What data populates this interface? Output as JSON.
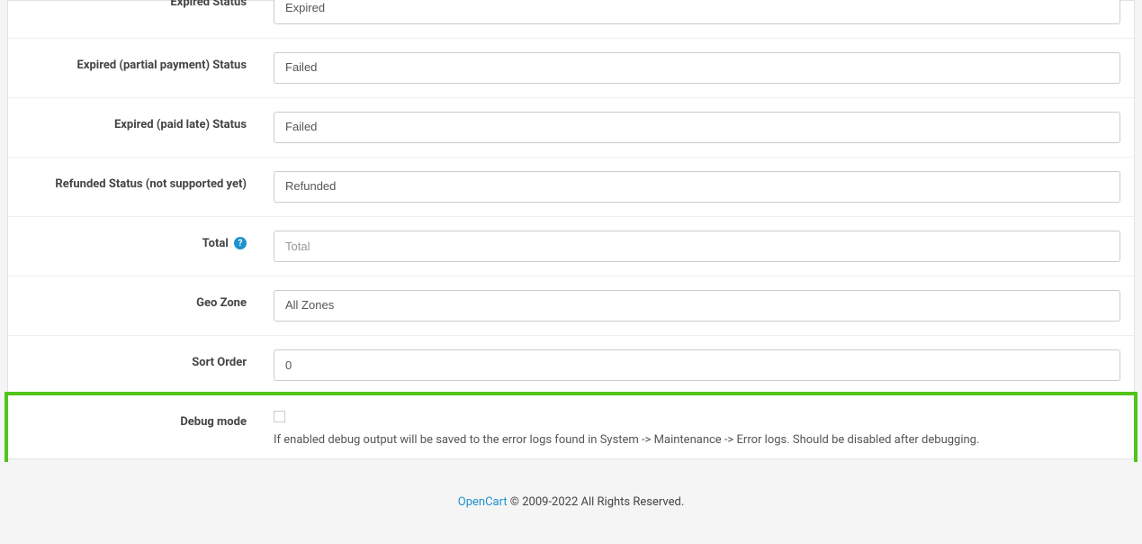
{
  "fields": {
    "expired_status": {
      "label": "Expired Status",
      "value": "Expired"
    },
    "expired_partial": {
      "label": "Expired (partial payment) Status",
      "value": "Failed"
    },
    "expired_paid_late": {
      "label": "Expired (paid late) Status",
      "value": "Failed"
    },
    "refunded": {
      "label": "Refunded Status (not supported yet)",
      "value": "Refunded"
    },
    "total": {
      "label": "Total",
      "placeholder": "Total",
      "value": ""
    },
    "geo_zone": {
      "label": "Geo Zone",
      "value": "All Zones"
    },
    "sort_order": {
      "label": "Sort Order",
      "value": "0"
    },
    "debug_mode": {
      "label": "Debug mode",
      "help": "If enabled debug output will be saved to the error logs found in System -> Maintenance -> Error logs. Should be disabled after debugging."
    }
  },
  "footer": {
    "link_text": "OpenCart",
    "copyright": " © 2009-2022 All Rights Reserved."
  }
}
